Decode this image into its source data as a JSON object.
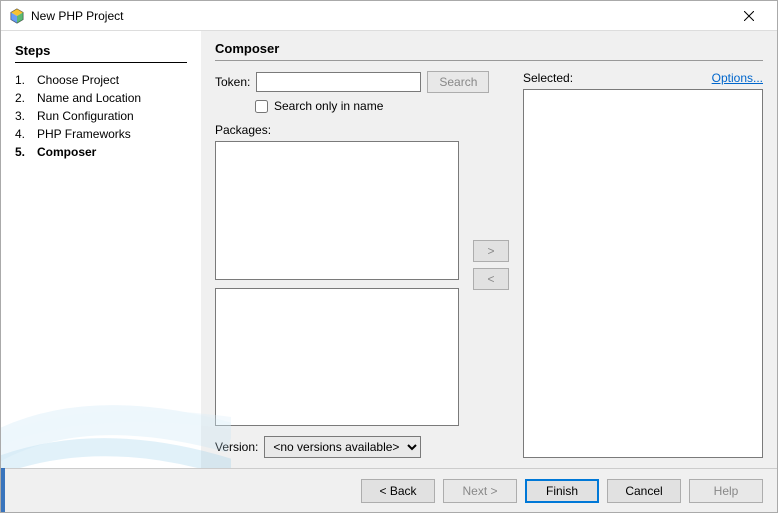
{
  "window": {
    "title": "New PHP Project"
  },
  "sidebar": {
    "heading": "Steps",
    "items": [
      {
        "num": "1.",
        "label": "Choose Project"
      },
      {
        "num": "2.",
        "label": "Name and Location"
      },
      {
        "num": "3.",
        "label": "Run Configuration"
      },
      {
        "num": "4.",
        "label": "PHP Frameworks"
      },
      {
        "num": "5.",
        "label": "Composer"
      }
    ],
    "current_index": 4
  },
  "main": {
    "heading": "Composer",
    "token_label": "Token:",
    "token_value": "",
    "search_button": "Search",
    "search_only_label": "Search only in name",
    "packages_label": "Packages:",
    "selected_label": "Selected:",
    "options_link": "Options...",
    "move_right": ">",
    "move_left": "<",
    "version_label": "Version:",
    "version_value": "<no versions available>"
  },
  "footer": {
    "back": "< Back",
    "next": "Next >",
    "finish": "Finish",
    "cancel": "Cancel",
    "help": "Help"
  }
}
